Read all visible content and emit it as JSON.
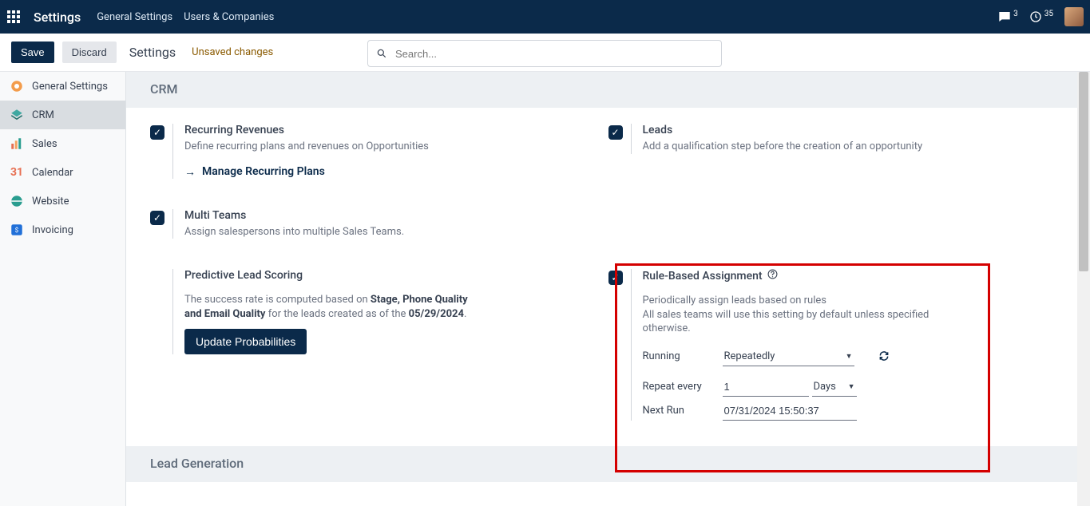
{
  "navbar": {
    "title": "Settings",
    "links": [
      "General Settings",
      "Users & Companies"
    ],
    "chat_count": "3",
    "activity_count": "35"
  },
  "controlbar": {
    "save": "Save",
    "discard": "Discard",
    "title": "Settings",
    "status": "Unsaved changes",
    "search_placeholder": "Search..."
  },
  "sidebar": {
    "items": [
      {
        "label": "General Settings"
      },
      {
        "label": "CRM"
      },
      {
        "label": "Sales"
      },
      {
        "label": "Calendar"
      },
      {
        "label": "Website"
      },
      {
        "label": "Invoicing"
      }
    ]
  },
  "section": {
    "title": "CRM"
  },
  "cards": {
    "recurring": {
      "title": "Recurring Revenues",
      "desc": "Define recurring plans and revenues on Opportunities",
      "link": "Manage Recurring Plans"
    },
    "leads": {
      "title": "Leads",
      "desc": "Add a qualification step before the creation of an opportunity"
    },
    "multi": {
      "title": "Multi Teams",
      "desc": "Assign salespersons into multiple Sales Teams."
    },
    "predictive": {
      "title": "Predictive Lead Scoring",
      "desc_pre": "The success rate is computed based on ",
      "desc_bold": "Stage, Phone Quality and Email Quality",
      "desc_mid": " for the leads created as of the ",
      "desc_date": "05/29/2024",
      "desc_post": ".",
      "button": "Update Probabilities"
    },
    "rule": {
      "title": "Rule-Based Assignment",
      "desc1": "Periodically assign leads based on rules",
      "desc2": "All sales teams will use this setting by default unless specified otherwise.",
      "running_label": "Running",
      "running_value": "Repeatedly",
      "repeat_label1": "Repeat every",
      "repeat_value": "1",
      "repeat_unit": "Days",
      "next_run_label": "Next Run",
      "next_run_value": "07/31/2024 15:50:37"
    }
  },
  "section2": {
    "title": "Lead Generation"
  }
}
